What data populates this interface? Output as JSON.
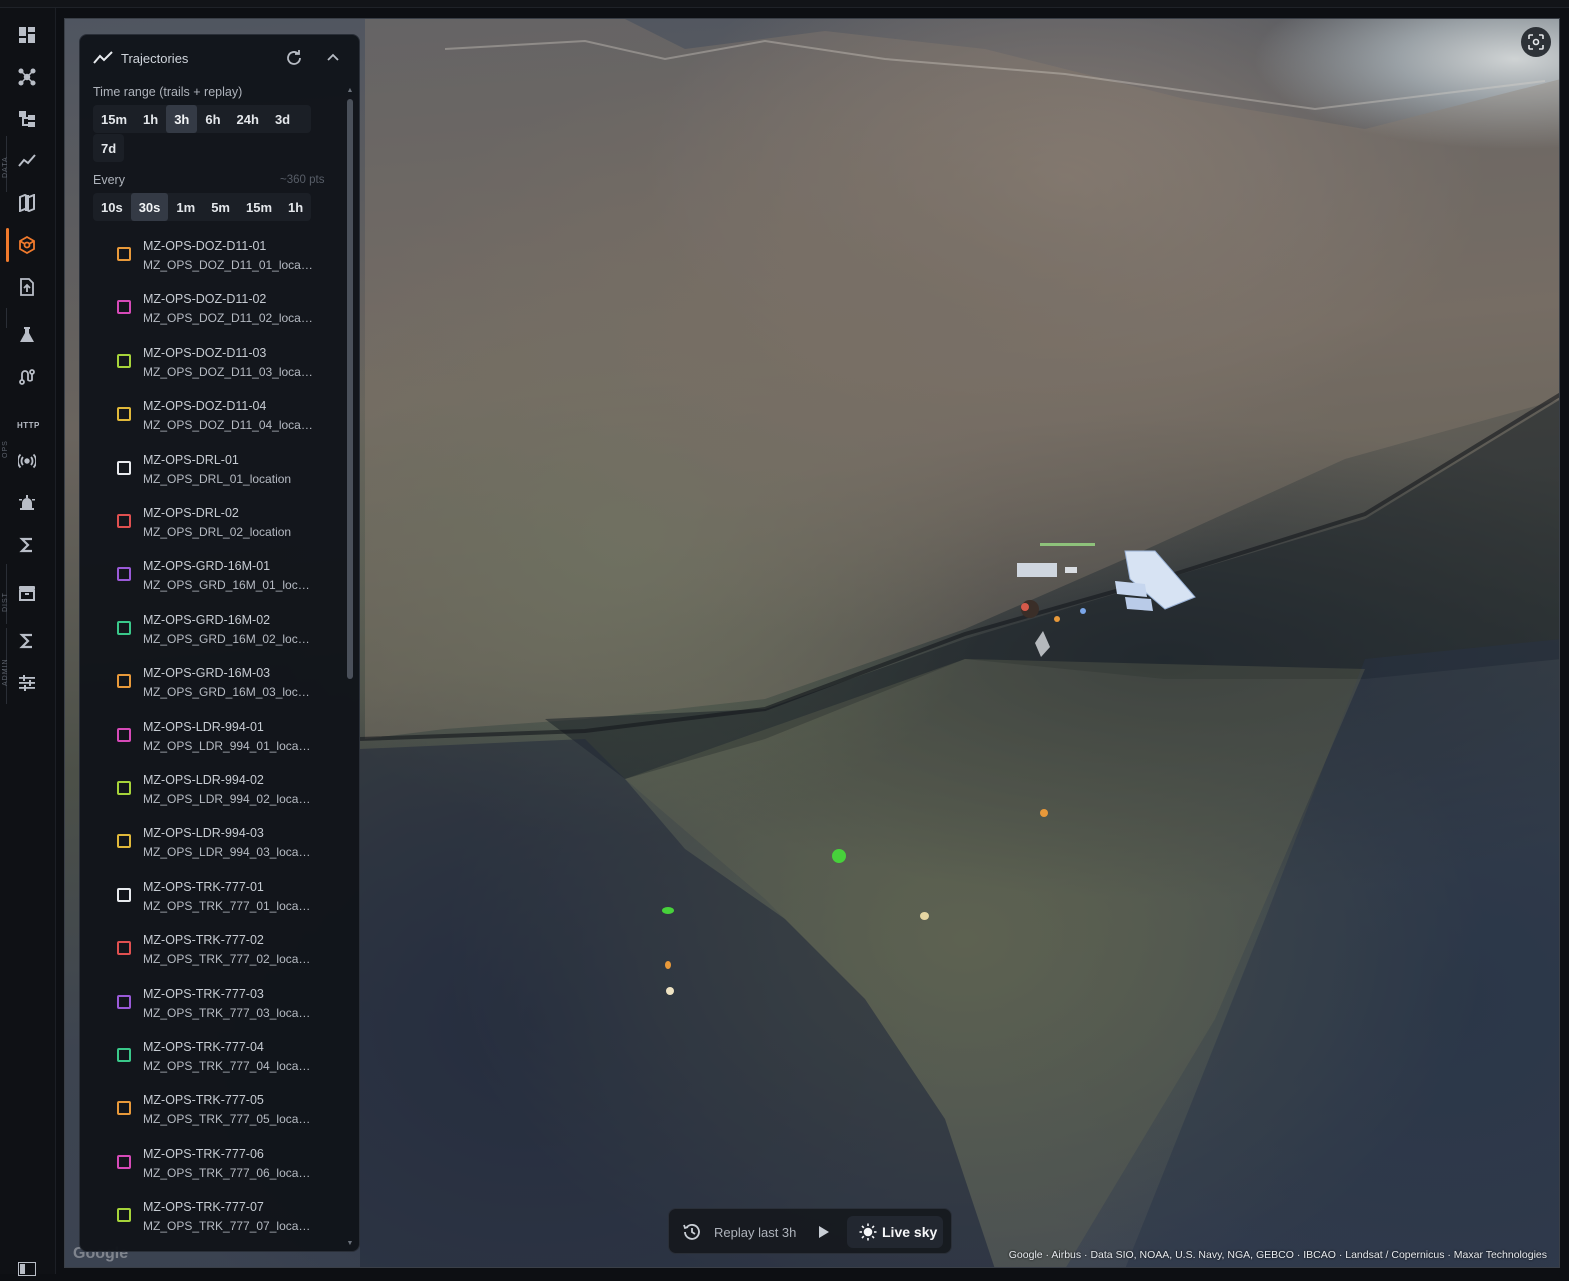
{
  "sidebar": {
    "sections": [
      "DATA",
      "OPS",
      "DIST",
      "ADMIN"
    ],
    "http_label": "HTTP",
    "icons": [
      "dashboard-icon",
      "network-icon",
      "hierarchy-icon",
      "chart-line-icon",
      "map-icon",
      "scene-3d-icon",
      "upload-doc-icon",
      "flask-icon",
      "routes-icon",
      "broadcast-icon",
      "alarm-icon",
      "sigma-icon",
      "archive-icon",
      "sigma-admin-icon",
      "sliders-icon"
    ]
  },
  "panel": {
    "title": "Trajectories",
    "time_range_label": "Time range (trails + replay)",
    "time_ranges": [
      "15m",
      "1h",
      "3h",
      "6h",
      "24h",
      "3d",
      "7d"
    ],
    "time_range_selected": "3h",
    "every_label": "Every",
    "points_hint": "~360 pts",
    "intervals": [
      "10s",
      "30s",
      "1m",
      "5m",
      "15m",
      "1h"
    ],
    "interval_selected": "30s",
    "items": [
      {
        "name": "MZ-OPS-DOZ-D11-01",
        "sub": "MZ_OPS_DOZ_D11_01_location",
        "color": "#e8993a"
      },
      {
        "name": "MZ-OPS-DOZ-D11-02",
        "sub": "MZ_OPS_DOZ_D11_02_location",
        "color": "#d64ab8"
      },
      {
        "name": "MZ-OPS-DOZ-D11-03",
        "sub": "MZ_OPS_DOZ_D11_03_location",
        "color": "#a6d33a"
      },
      {
        "name": "MZ-OPS-DOZ-D11-04",
        "sub": "MZ_OPS_DOZ_D11_04_location",
        "color": "#e0b83a"
      },
      {
        "name": "MZ-OPS-DRL-01",
        "sub": "MZ_OPS_DRL_01_location",
        "color": "#e8eaee"
      },
      {
        "name": "MZ-OPS-DRL-02",
        "sub": "MZ_OPS_DRL_02_location",
        "color": "#e05050"
      },
      {
        "name": "MZ-OPS-GRD-16M-01",
        "sub": "MZ_OPS_GRD_16M_01_location",
        "color": "#9a5ad8"
      },
      {
        "name": "MZ-OPS-GRD-16M-02",
        "sub": "MZ_OPS_GRD_16M_02_location",
        "color": "#3ac88a"
      },
      {
        "name": "MZ-OPS-GRD-16M-03",
        "sub": "MZ_OPS_GRD_16M_03_location",
        "color": "#e8993a"
      },
      {
        "name": "MZ-OPS-LDR-994-01",
        "sub": "MZ_OPS_LDR_994_01_location",
        "color": "#d64ab8"
      },
      {
        "name": "MZ-OPS-LDR-994-02",
        "sub": "MZ_OPS_LDR_994_02_location",
        "color": "#a6d33a"
      },
      {
        "name": "MZ-OPS-LDR-994-03",
        "sub": "MZ_OPS_LDR_994_03_location",
        "color": "#e0b83a"
      },
      {
        "name": "MZ-OPS-TRK-777-01",
        "sub": "MZ_OPS_TRK_777_01_location",
        "color": "#e8eaee"
      },
      {
        "name": "MZ-OPS-TRK-777-02",
        "sub": "MZ_OPS_TRK_777_02_location",
        "color": "#e05050"
      },
      {
        "name": "MZ-OPS-TRK-777-03",
        "sub": "MZ_OPS_TRK_777_03_location",
        "color": "#9a5ad8"
      },
      {
        "name": "MZ-OPS-TRK-777-04",
        "sub": "MZ_OPS_TRK_777_04_location",
        "color": "#3ac88a"
      },
      {
        "name": "MZ-OPS-TRK-777-05",
        "sub": "MZ_OPS_TRK_777_05_location",
        "color": "#e8993a"
      },
      {
        "name": "MZ-OPS-TRK-777-06",
        "sub": "MZ_OPS_TRK_777_06_location",
        "color": "#d64ab8"
      },
      {
        "name": "MZ-OPS-TRK-777-07",
        "sub": "MZ_OPS_TRK_777_07_location",
        "color": "#a6d33a"
      }
    ]
  },
  "replay": {
    "label": "Replay last 3h",
    "live_label": "Live sky"
  },
  "map": {
    "attribution": "Google · Airbus · Data SIO, NOAA, U.S. Navy, NGA, GEBCO · IBCAO · Landsat / Copernicus · Maxar Technologies",
    "logo": "Google"
  }
}
